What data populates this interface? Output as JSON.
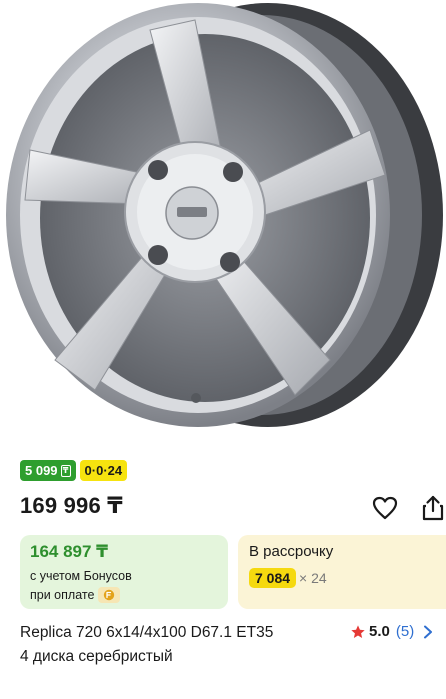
{
  "product": {
    "image_alt": "Replica 720 alloy wheel, silver, 5-spoke"
  },
  "badges": {
    "bonus_price": "5 099",
    "bonus_currency_icon": "tenge-card-icon",
    "installment_badge": "0·0·24"
  },
  "price": {
    "main": "169 996 ₸"
  },
  "actions": {
    "favorite_icon": "heart-icon",
    "share_icon": "share-icon"
  },
  "bonus_card": {
    "price": "164 897 ₸",
    "note_line1": "с учетом Бонусов",
    "note_line2": "при оплате",
    "coin_icon": "bonus-coin-icon"
  },
  "installment_card": {
    "title": "В рассрочку",
    "monthly": "7 084",
    "multiplier": "× 24"
  },
  "title": {
    "line1": "Replica 720 6x14/4x100 D67.1 ET35",
    "line2": "4 диска серебристый"
  },
  "rating": {
    "value": "5.0",
    "count": "(5)",
    "star_color": "#e53935",
    "link_color": "#2f6fd0"
  },
  "colors": {
    "green_badge": "#2e9e2e",
    "yellow_badge": "#f6e30f",
    "bonus_card_bg": "#e4f5dc",
    "installment_card_bg": "#fbf4d6",
    "bonus_price_text": "#2e8f2e"
  }
}
